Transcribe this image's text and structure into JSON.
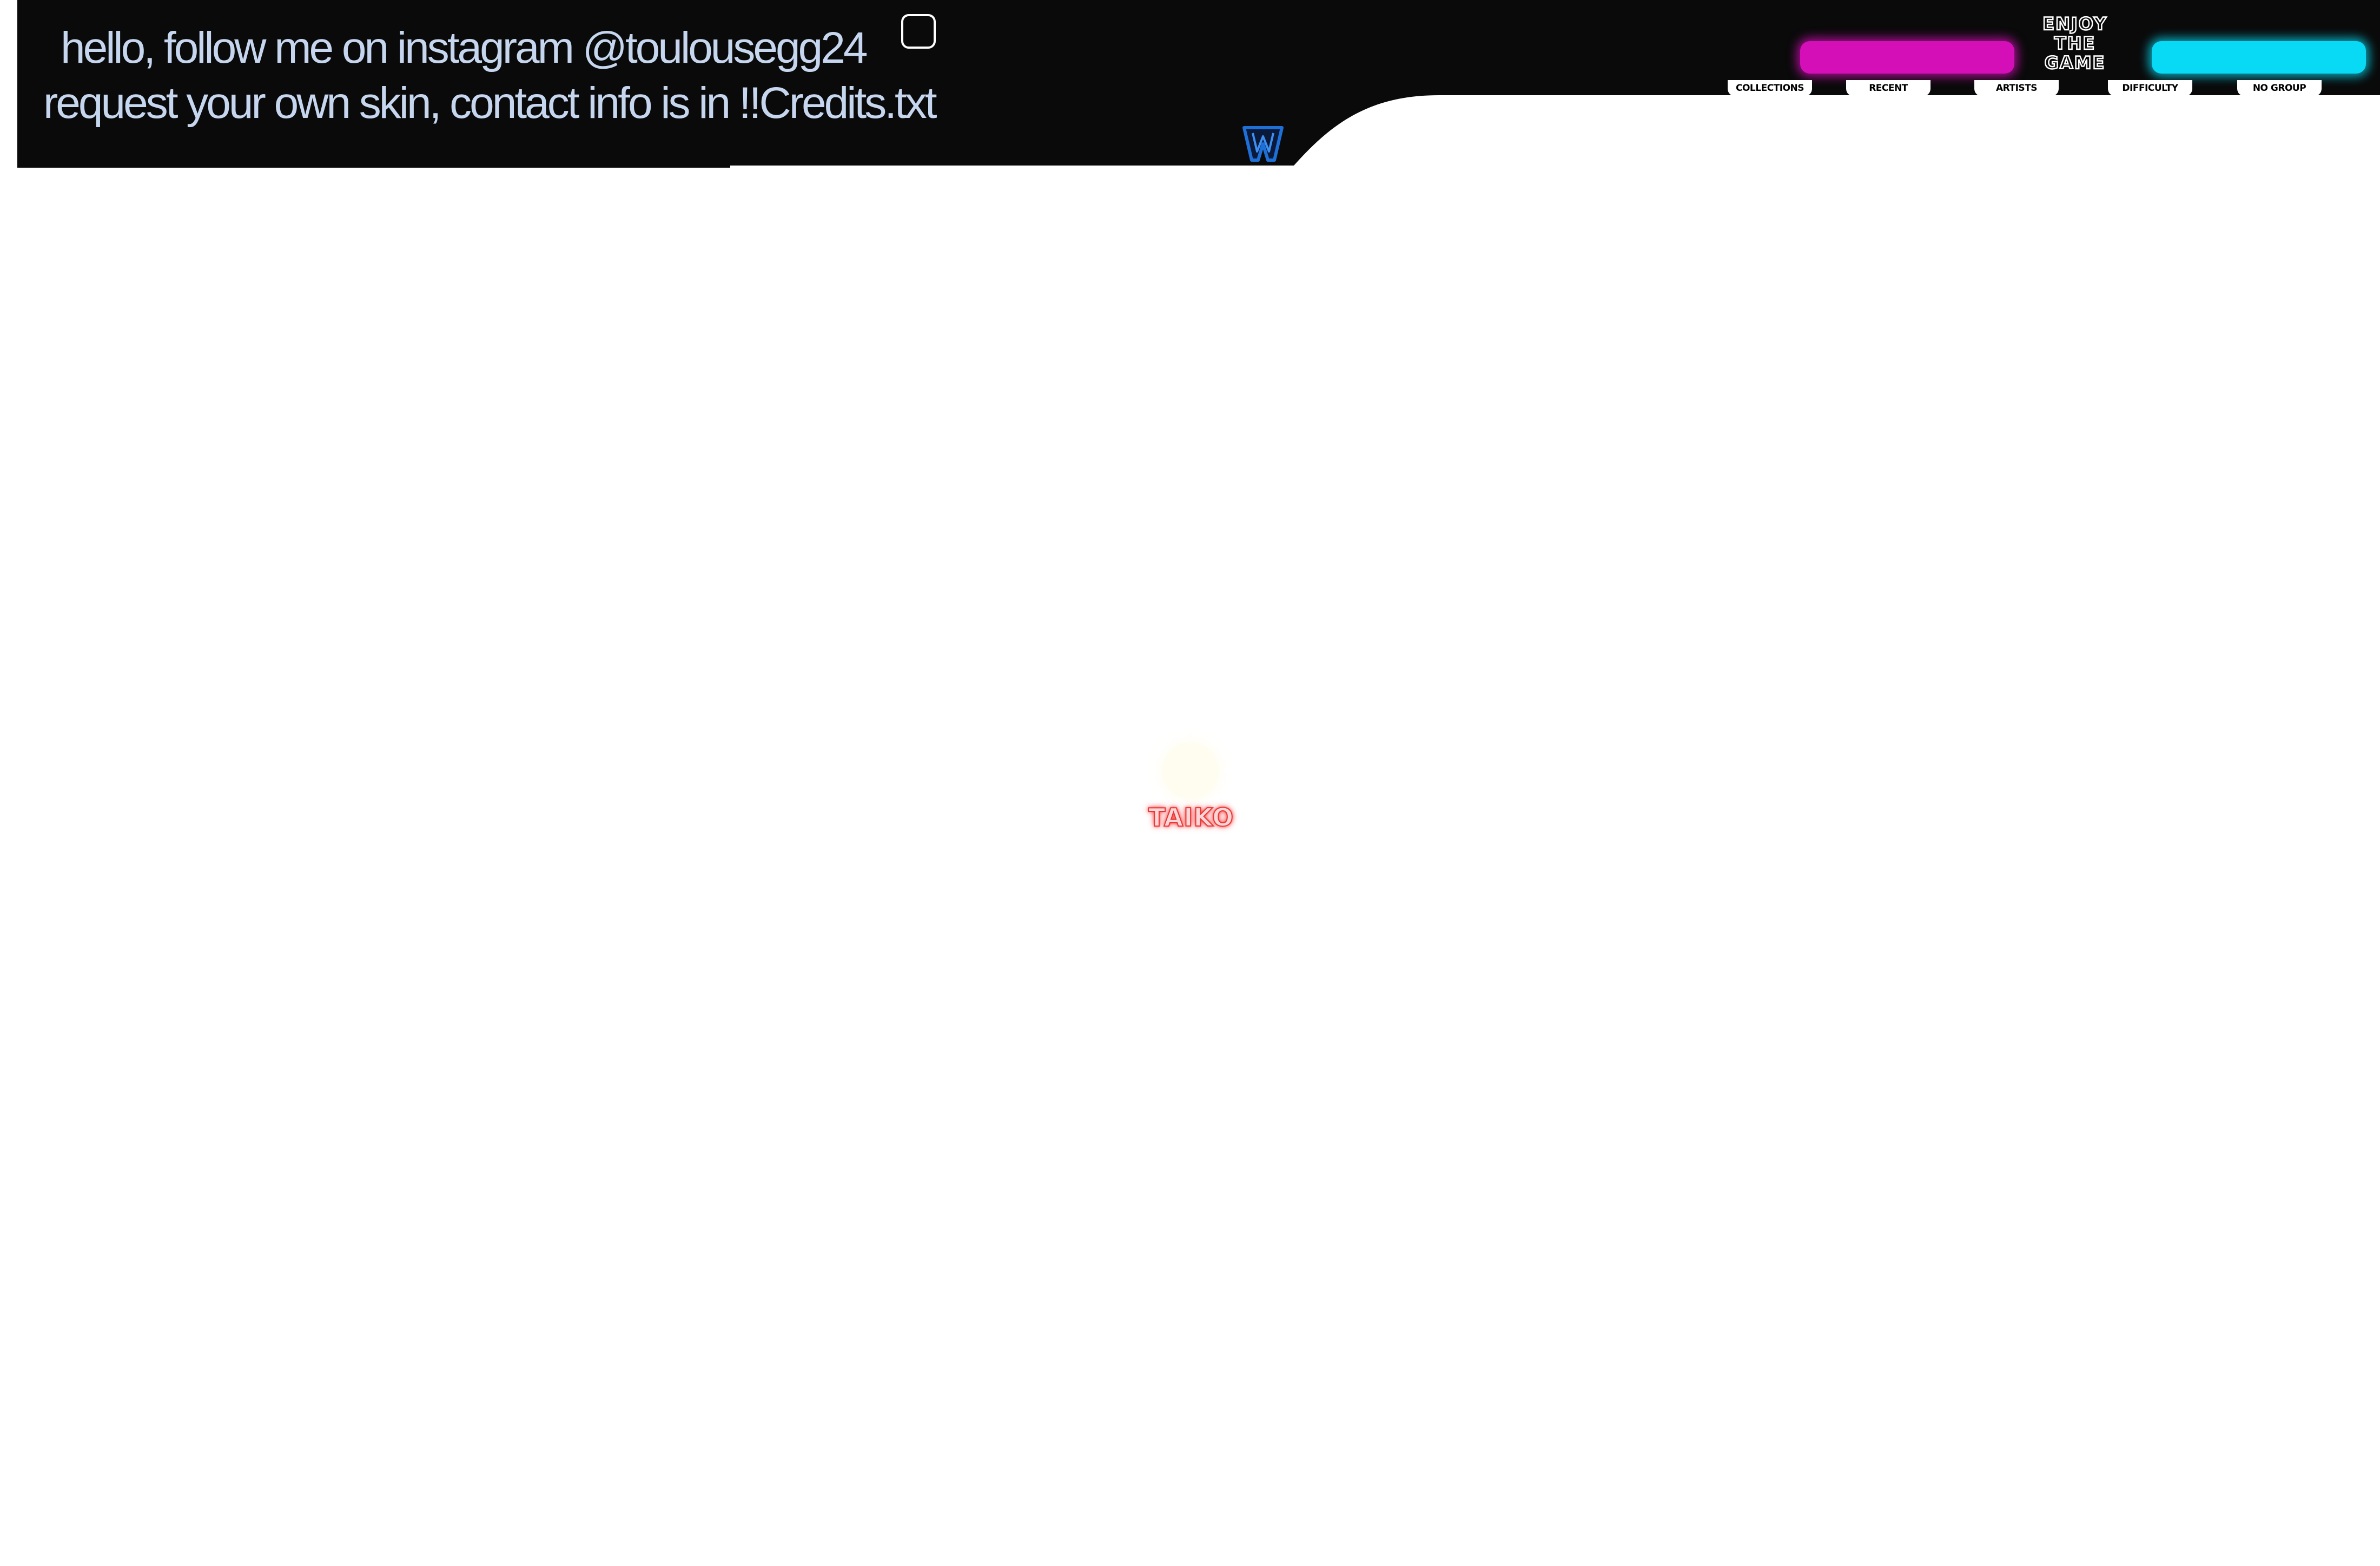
{
  "info": {
    "line1": "hello, follow me on instagram @toulousegg24",
    "line2": "request your own skin, contact info is in !!Credits.txt"
  },
  "logo": {
    "line1": "ENJOY",
    "line2": "THE",
    "line3": "GAME"
  },
  "group_tabs": [
    {
      "label": "COLLECTIONS"
    },
    {
      "label": "RECENT"
    },
    {
      "label": "ARTISTS"
    },
    {
      "label": "DIFFICULTY"
    },
    {
      "label": "NO GROUP"
    }
  ],
  "mode": {
    "label": "TAIKO",
    "icon": "taiko-drum-icon"
  },
  "icons": {
    "square": "square-outline-icon",
    "w_logo": "w-logo-icon"
  },
  "colors": {
    "bar_background": "#0a0a0a",
    "info_text": "#c6d6ee",
    "neon_pink": "#d40fb8",
    "neon_cyan": "#08d9f4",
    "mode_label": "#e23a3a",
    "w_logo": "#1e6fd6"
  }
}
